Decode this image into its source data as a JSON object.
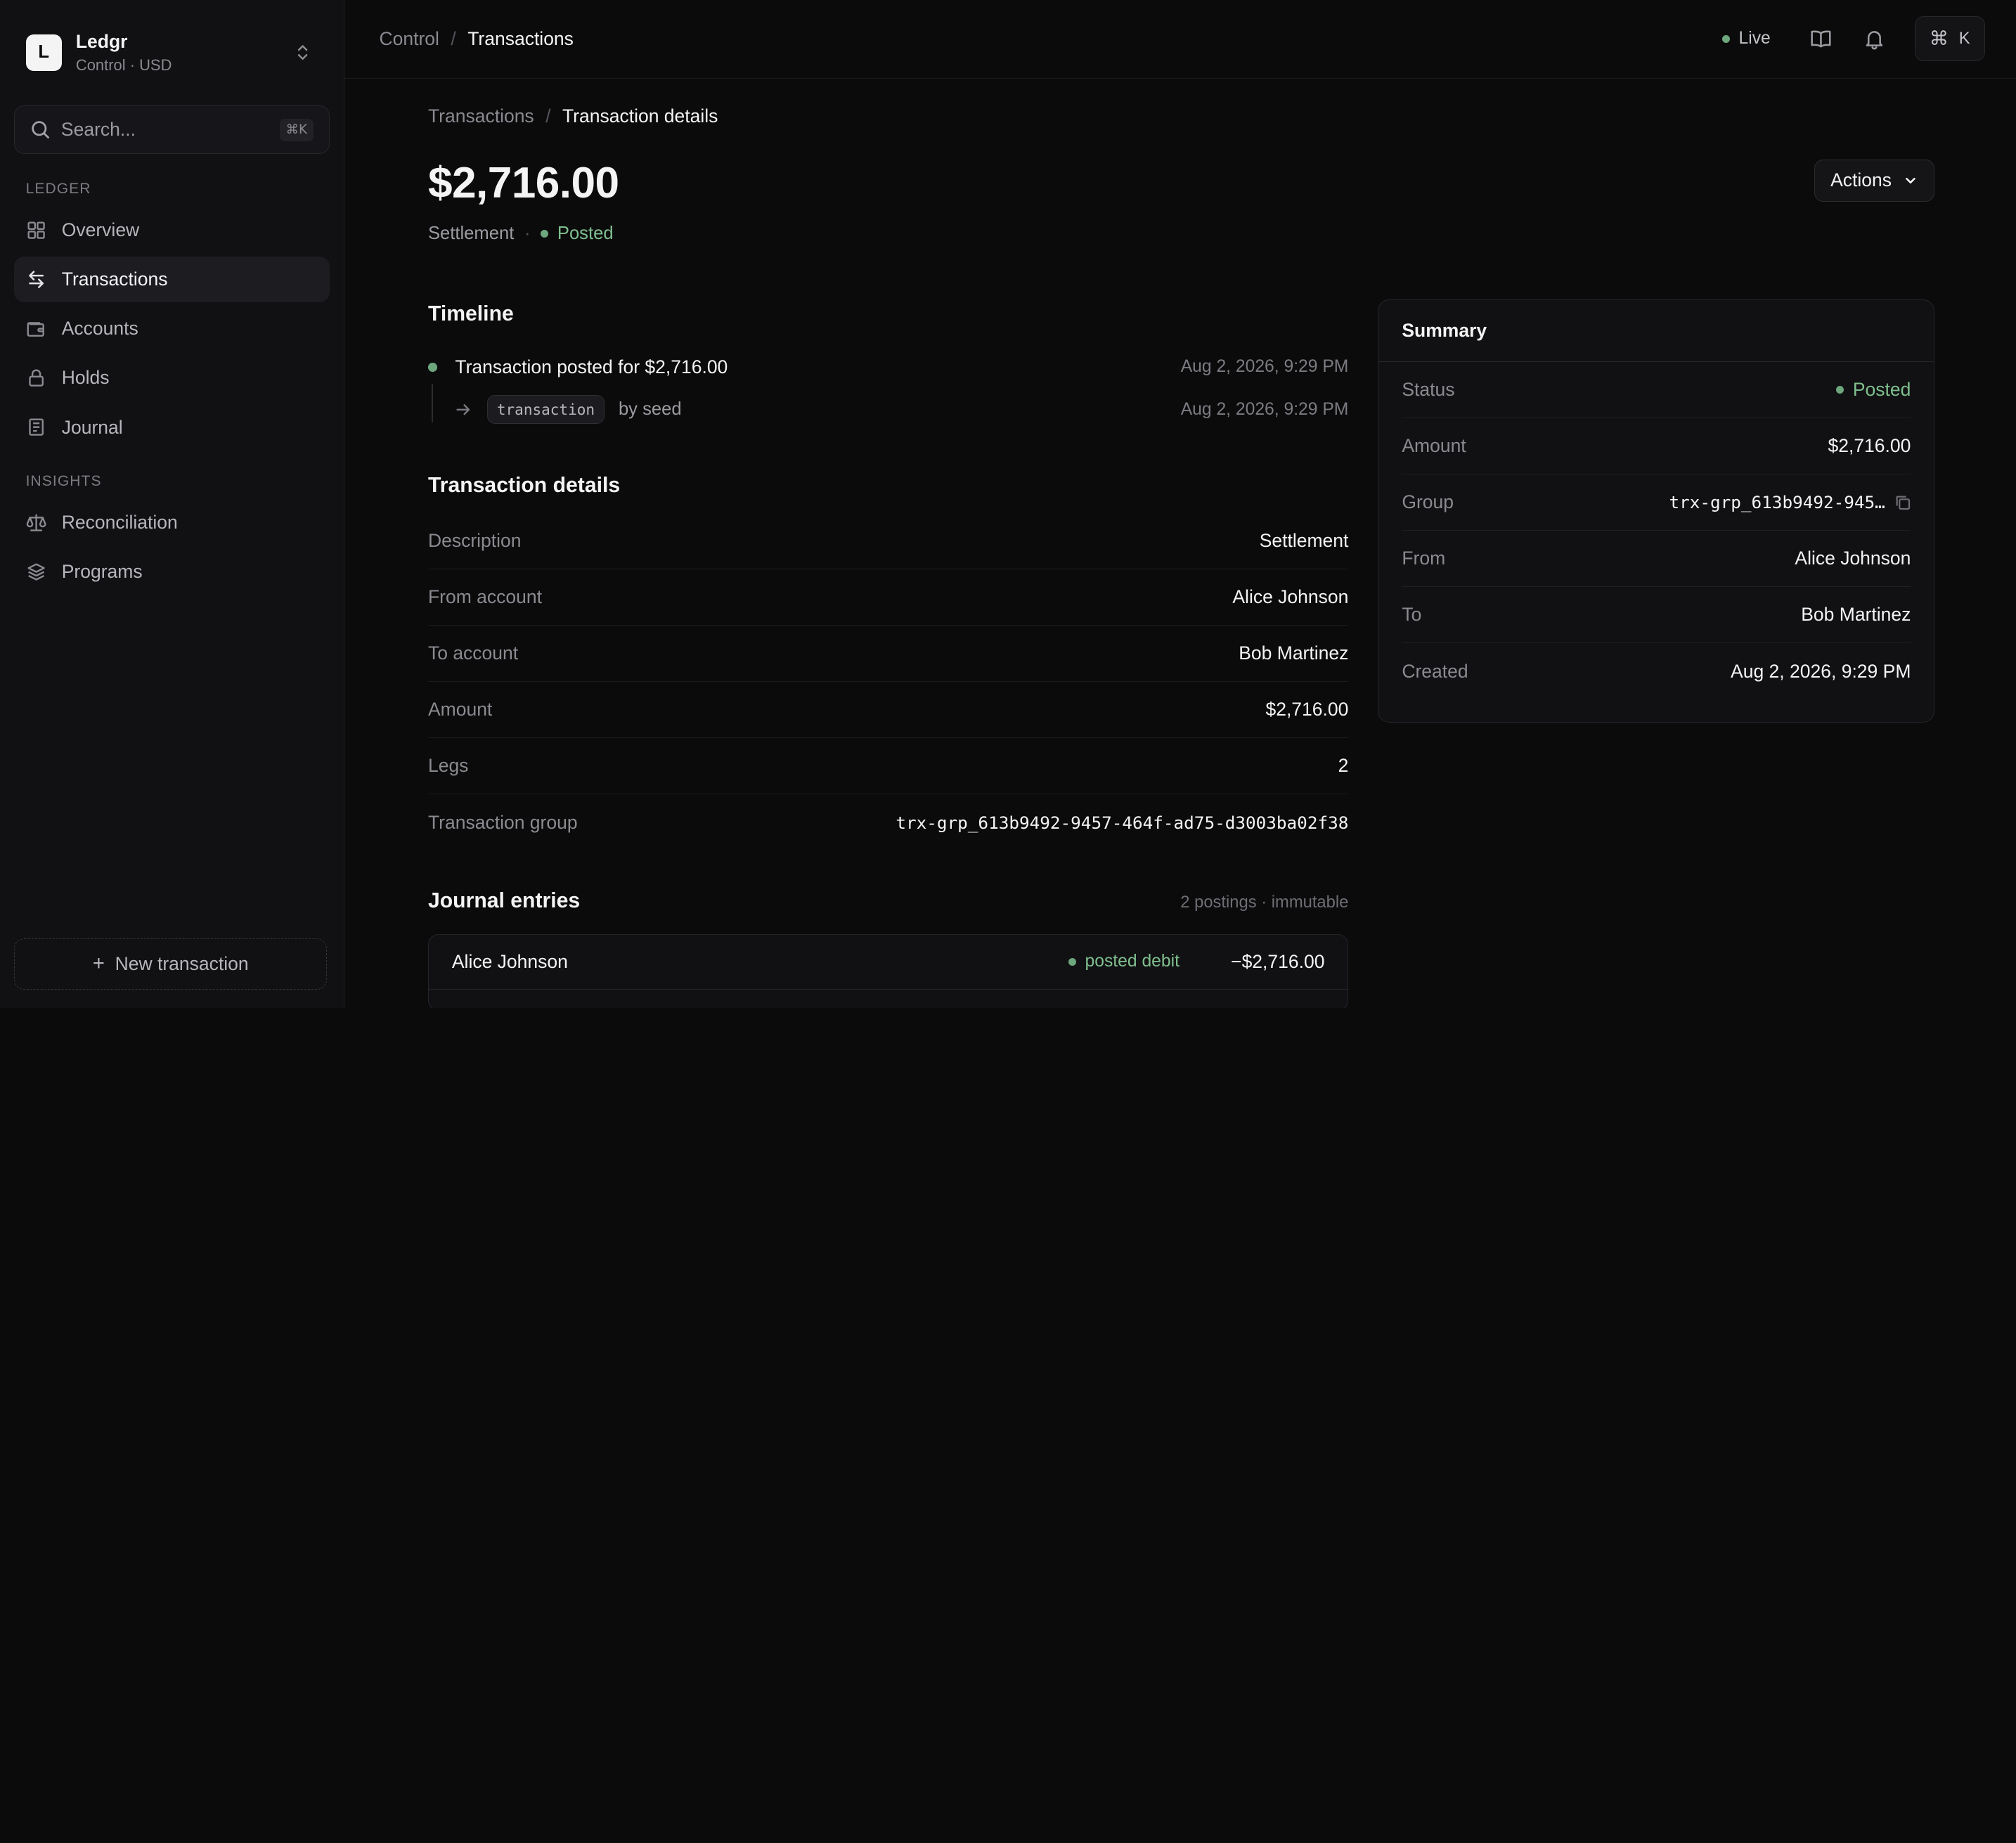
{
  "org": {
    "logo_letter": "L",
    "name": "Ledgr",
    "sub": "Control · USD"
  },
  "search": {
    "placeholder": "Search...",
    "shortcut": "⌘K"
  },
  "sidebar": {
    "sections": [
      {
        "label": "LEDGER"
      },
      {
        "label": "INSIGHTS"
      }
    ],
    "items": [
      {
        "label": "Overview",
        "icon": "grid-icon"
      },
      {
        "label": "Transactions",
        "icon": "arrows-swap-icon",
        "active": true
      },
      {
        "label": "Accounts",
        "icon": "wallet-icon"
      },
      {
        "label": "Holds",
        "icon": "lock-icon"
      },
      {
        "label": "Journal",
        "icon": "book-icon"
      },
      {
        "label": "Reconciliation",
        "icon": "scale-icon"
      },
      {
        "label": "Programs",
        "icon": "layers-icon"
      }
    ],
    "new_tx": "New transaction"
  },
  "topbar": {
    "crumb_root": "Control",
    "crumb_current": "Transactions",
    "live": "Live",
    "cmd_symbol": "⌘",
    "cmd_key": "K"
  },
  "page": {
    "crumb_parent": "Transactions",
    "crumb_current": "Transaction details",
    "amount": "$2,716.00",
    "type": "Settlement",
    "status": "Posted",
    "actions": "Actions"
  },
  "timeline": {
    "title": "Timeline",
    "event_title": "Transaction posted for $2,716.00",
    "event_time": "Aug 2, 2026, 9:29 PM",
    "sub_tag": "transaction",
    "sub_by": "by seed",
    "sub_time": "Aug 2, 2026, 9:29 PM"
  },
  "details": {
    "title": "Transaction details",
    "rows": [
      {
        "key": "Description",
        "value": "Settlement"
      },
      {
        "key": "From account",
        "value": "Alice Johnson"
      },
      {
        "key": "To account",
        "value": "Bob Martinez"
      },
      {
        "key": "Amount",
        "value": "$2,716.00"
      },
      {
        "key": "Legs",
        "value": "2"
      },
      {
        "key": "Transaction group",
        "value": "trx-grp_613b9492-9457-464f-ad75-d3003ba02f38"
      }
    ]
  },
  "journal": {
    "title": "Journal entries",
    "meta": "2 postings · immutable",
    "rows": [
      {
        "name": "Alice Johnson",
        "badge": "posted debit",
        "amount": "−$2,716.00"
      }
    ]
  },
  "summary": {
    "title": "Summary",
    "rows": [
      {
        "key": "Status",
        "value": "Posted"
      },
      {
        "key": "Amount",
        "value": "$2,716.00"
      },
      {
        "key": "Group",
        "value": "trx-grp_613b9492-945…"
      },
      {
        "key": "From",
        "value": "Alice Johnson"
      },
      {
        "key": "To",
        "value": "Bob Martinez"
      },
      {
        "key": "Created",
        "value": "Aug 2, 2026, 9:29 PM"
      }
    ]
  },
  "colors": {
    "accent_green": "#6ea77d",
    "background": "#0b0b0c",
    "sidebar": "#111113"
  }
}
